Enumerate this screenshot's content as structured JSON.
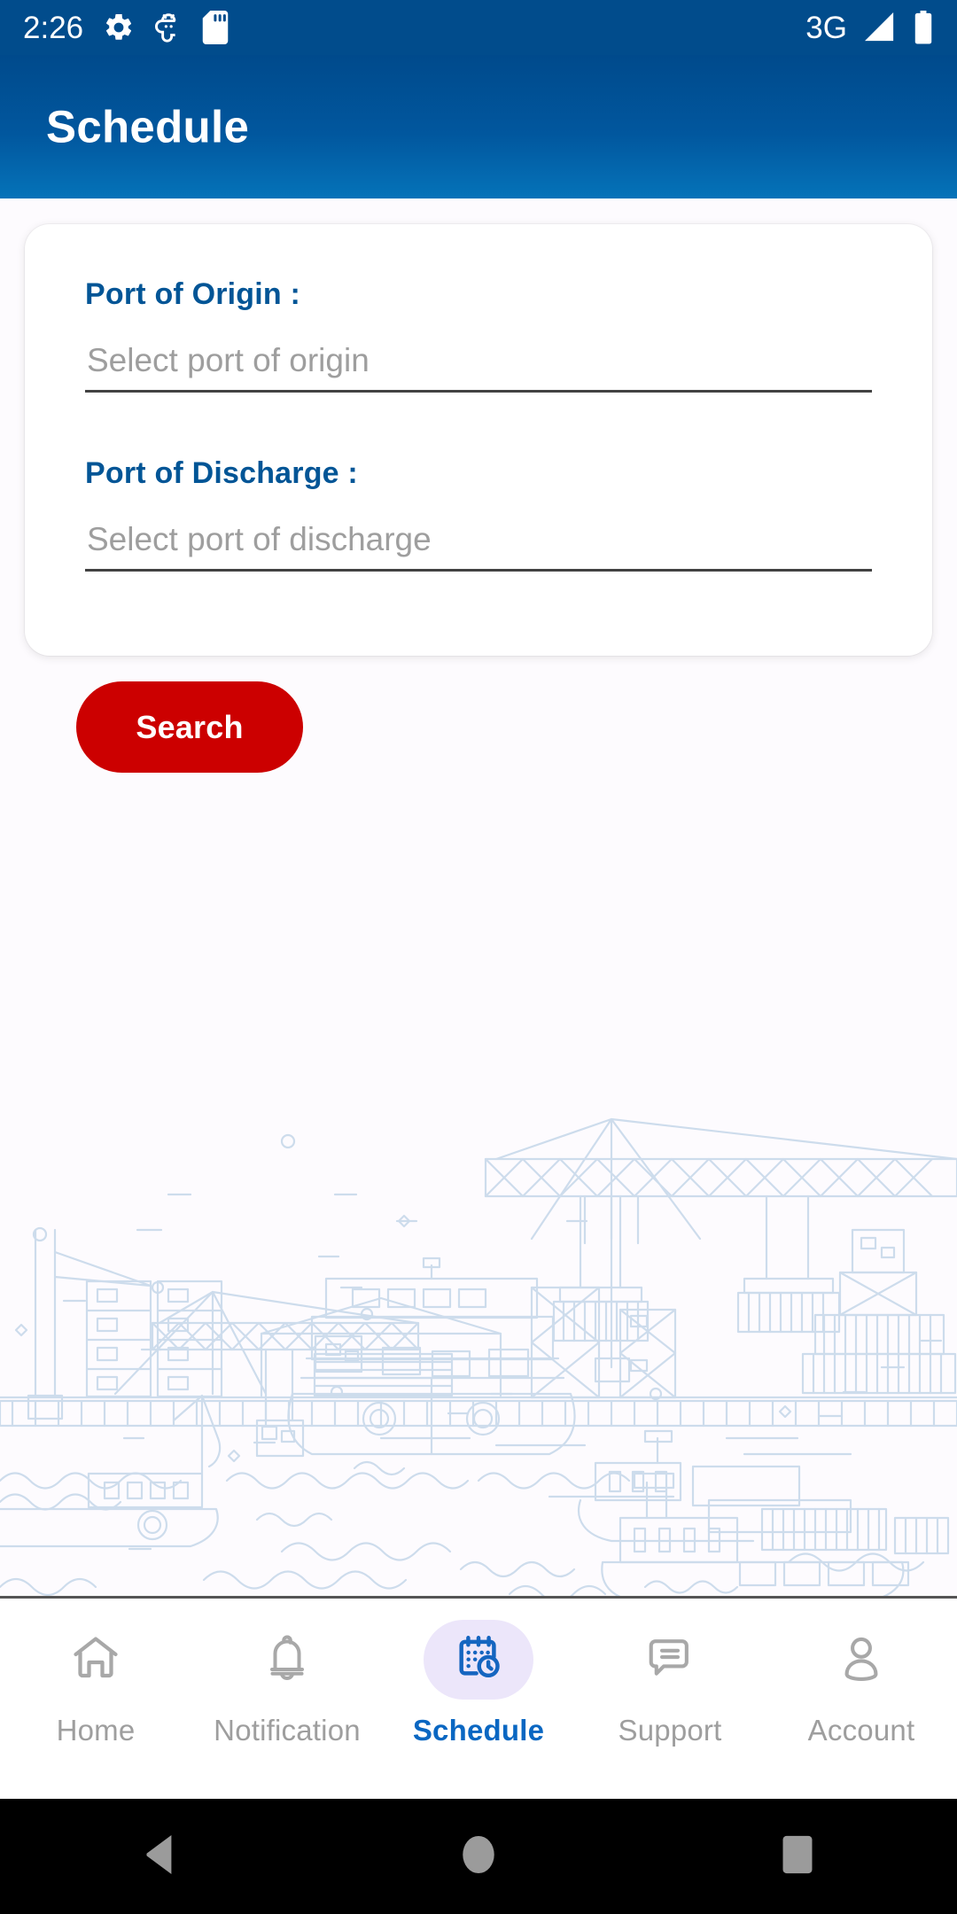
{
  "status_bar": {
    "clock": "2:26",
    "network": "3G",
    "icons": [
      "gear-icon",
      "android-debug-icon",
      "sd-card-icon"
    ],
    "signal_icon": "signal-bars-icon",
    "battery_icon": "battery-full-icon",
    "background": "#014c8c"
  },
  "app_bar": {
    "title": "Schedule",
    "gradient_from": "#004a8c",
    "gradient_to": "#0573b9"
  },
  "form": {
    "origin": {
      "label": "Port of Origin :",
      "placeholder": "Select port of origin",
      "value": ""
    },
    "discharge": {
      "label": "Port of Discharge :",
      "placeholder": "Select port of discharge",
      "value": ""
    },
    "label_color": "#015596"
  },
  "search_button": {
    "label": "Search",
    "color": "#cc0000",
    "text_color": "#ffffff"
  },
  "illustration": {
    "name": "port-harbor-line-art",
    "stroke_color": "#ccdced"
  },
  "bottom_nav": {
    "active_index": 2,
    "active_color": "#0a67c2",
    "inactive_color": "#9e9e9e",
    "active_pill_color": "#ece6fa",
    "items": [
      {
        "label": "Home",
        "icon": "home-icon"
      },
      {
        "label": "Notification",
        "icon": "bell-icon"
      },
      {
        "label": "Schedule",
        "icon": "calendar-clock-icon"
      },
      {
        "label": "Support",
        "icon": "chat-bubble-icon"
      },
      {
        "label": "Account",
        "icon": "person-icon"
      }
    ]
  },
  "system_nav": {
    "background": "#000000",
    "buttons": [
      {
        "name": "back-button",
        "icon": "triangle-left-icon"
      },
      {
        "name": "home-button",
        "icon": "circle-icon"
      },
      {
        "name": "recents-button",
        "icon": "square-icon"
      }
    ]
  },
  "page": {
    "background": "#fdfbfe"
  }
}
